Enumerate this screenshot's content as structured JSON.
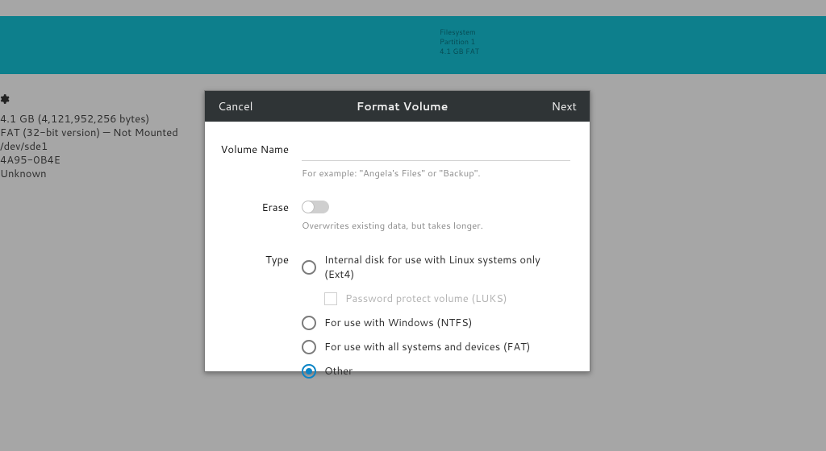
{
  "header": {
    "fs_label": "Filesystem",
    "partition": "Partition 1",
    "size_fs": "4.1 GB FAT"
  },
  "info": {
    "size": "4.1 GB (4,121,952,256 bytes)",
    "fs": "FAT (32-bit version) — Not Mounted",
    "device": "/dev/sde1",
    "uuid": "4A95-0B4E",
    "partition_type": "Unknown"
  },
  "dialog": {
    "cancel": "Cancel",
    "title": "Format Volume",
    "next": "Next",
    "volume_name_label": "Volume Name",
    "volume_name_value": "",
    "volume_name_hint": "For example: \"Angela's Files\" or \"Backup\".",
    "erase_label": "Erase",
    "erase_hint": "Overwrites existing data, but takes longer.",
    "type_label": "Type",
    "type_options": {
      "ext4": "Internal disk for use with Linux systems only (Ext4)",
      "luks": "Password protect volume (LUKS)",
      "ntfs": "For use with Windows (NTFS)",
      "fat": "For use with all systems and devices (FAT)",
      "other": "Other"
    },
    "type_selected": "other"
  }
}
